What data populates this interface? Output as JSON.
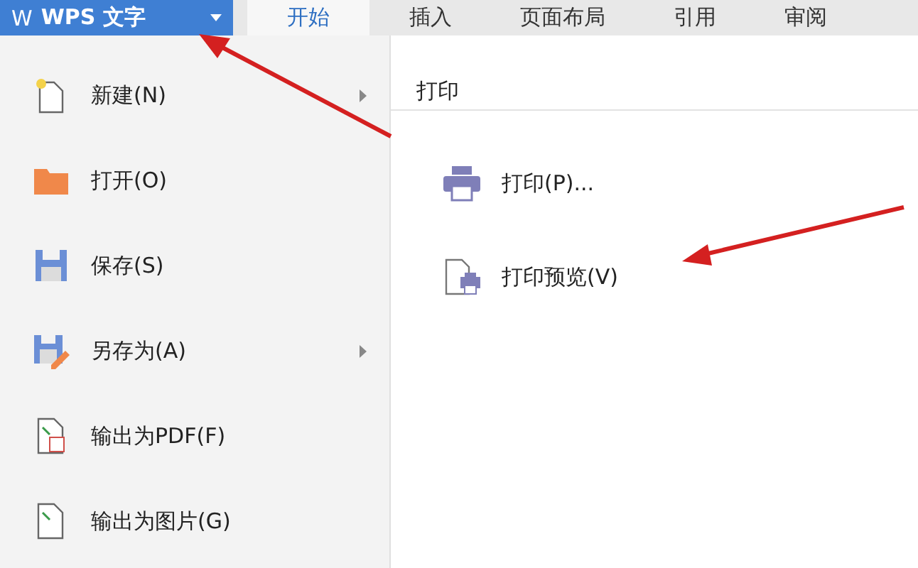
{
  "app_button": {
    "label": "WPS 文字",
    "logo": "W"
  },
  "tabs": [
    {
      "label": "开始",
      "selected": true
    },
    {
      "label": "插入",
      "selected": false
    },
    {
      "label": "页面布局",
      "selected": false
    },
    {
      "label": "引用",
      "selected": false
    },
    {
      "label": "审阅",
      "selected": false
    }
  ],
  "menu": {
    "items": [
      {
        "label": "新建(N)",
        "has_submenu": true
      },
      {
        "label": "打开(O)",
        "has_submenu": false
      },
      {
        "label": "保存(S)",
        "has_submenu": false
      },
      {
        "label": "另存为(A)",
        "has_submenu": true
      },
      {
        "label": "输出为PDF(F)",
        "has_submenu": false
      },
      {
        "label": "输出为图片(G)",
        "has_submenu": false
      }
    ]
  },
  "submenu": {
    "title": "打印",
    "items": [
      {
        "label": "打印(P)..."
      },
      {
        "label": "打印预览(V)"
      }
    ]
  }
}
